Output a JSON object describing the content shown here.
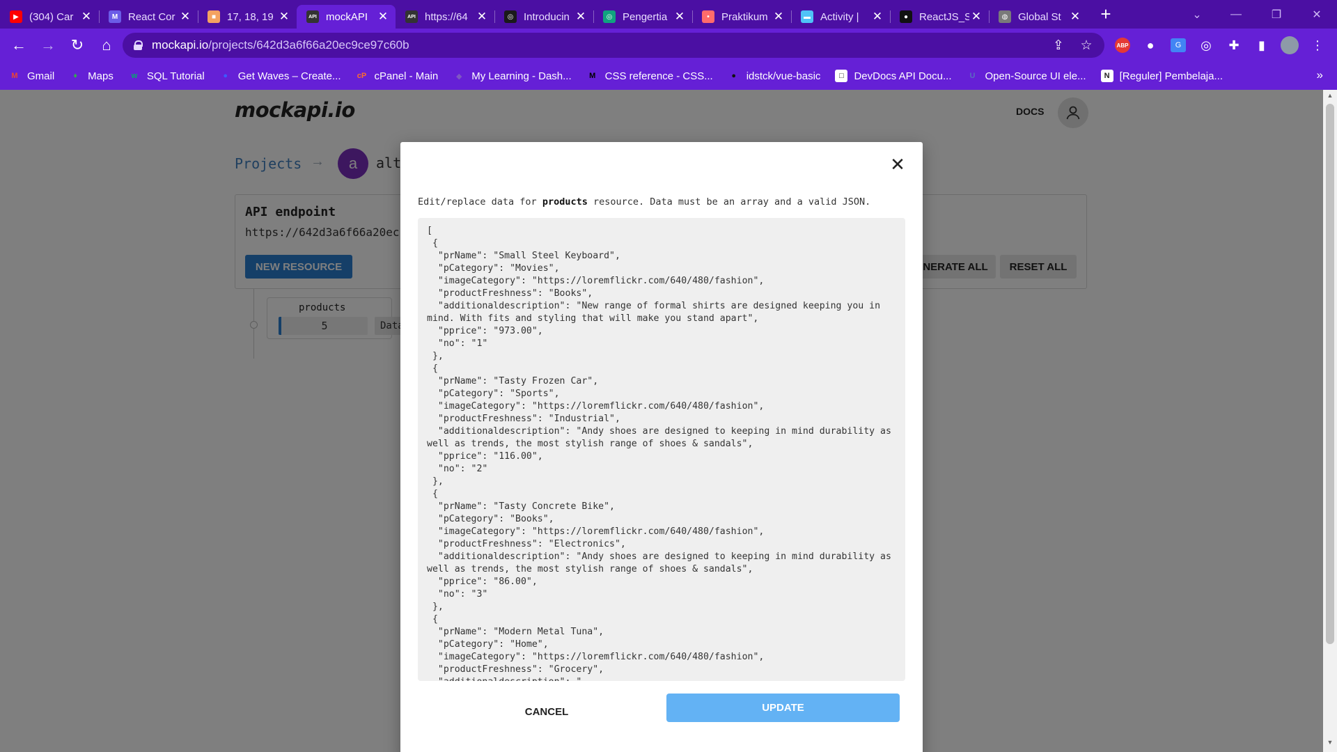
{
  "browser": {
    "tabs": [
      {
        "title": "(304) Car",
        "icon": "youtube-icon",
        "color": "#ff0000",
        "glyph": "▶"
      },
      {
        "title": "React Cor",
        "icon": "react-course-icon",
        "color": "#6b5ce7",
        "glyph": "M"
      },
      {
        "title": "17, 18, 19",
        "icon": "bookmark-page-icon",
        "color": "#f4a261",
        "glyph": "■"
      },
      {
        "title": "mockAPI",
        "icon": "mockapi-icon",
        "color": "#333333",
        "glyph": "API"
      },
      {
        "title": "https://64",
        "icon": "mockapi-icon",
        "color": "#333333",
        "glyph": "API"
      },
      {
        "title": "Introducin",
        "icon": "openai-icon",
        "color": "#1a1a1a",
        "glyph": "◎"
      },
      {
        "title": "Pengertia",
        "icon": "chatgpt-icon",
        "color": "#10a37f",
        "glyph": "◎"
      },
      {
        "title": "Praktikum",
        "icon": "web-icon",
        "color": "#ff6b6b",
        "glyph": "•"
      },
      {
        "title": "Activity |",
        "icon": "activity-icon",
        "color": "#4fc3f7",
        "glyph": "▬"
      },
      {
        "title": "ReactJS_S",
        "icon": "github-icon",
        "color": "#111111",
        "glyph": "●"
      },
      {
        "title": "Global St",
        "icon": "globe-icon",
        "color": "#7a7a7a",
        "glyph": "◍"
      }
    ],
    "url_host": "mockapi.io",
    "url_path": "/projects/642d3a6f66a20ec9ce97c60b",
    "bookmarks": [
      {
        "label": "Gmail",
        "icon": "gmail-icon",
        "color": "#ea4335",
        "glyph": "M"
      },
      {
        "label": "Maps",
        "icon": "maps-icon",
        "color": "#34a853",
        "glyph": "♦"
      },
      {
        "label": "SQL Tutorial",
        "icon": "w3schools-icon",
        "color": "#04aa6d",
        "glyph": "w"
      },
      {
        "label": "Get Waves – Create...",
        "icon": "waves-icon",
        "color": "#3d5afe",
        "glyph": "●"
      },
      {
        "label": "cPanel - Main",
        "icon": "cpanel-icon",
        "color": "#ff6c2c",
        "glyph": "cP"
      },
      {
        "label": "My Learning - Dash...",
        "icon": "learning-icon",
        "color": "#7e57c2",
        "glyph": "◆"
      },
      {
        "label": "CSS reference - CSS...",
        "icon": "mdn-icon",
        "color": "#000000",
        "glyph": "M"
      },
      {
        "label": "idstck/vue-basic",
        "icon": "github-icon",
        "color": "#111111",
        "glyph": "●"
      },
      {
        "label": "DevDocs API Docu...",
        "icon": "devdocs-icon",
        "color": "#ffffff",
        "glyph": "□"
      },
      {
        "label": "Open-Source UI ele...",
        "icon": "ui-icon",
        "color": "#5c6bc0",
        "glyph": "U"
      },
      {
        "label": "[Reguler] Pembelaja...",
        "icon": "notion-icon",
        "color": "#ffffff",
        "glyph": "N"
      }
    ]
  },
  "page": {
    "logo": "mockapi.io",
    "docs_label": "DOCS",
    "breadcrumb_projects": "Projects",
    "project_avatar_letter": "a",
    "project_name": "alt",
    "card_title": "API endpoint",
    "card_url": "https://642d3a6f66a20ec",
    "new_resource_label": "NEW RESOURCE",
    "generate_all_label": "NERATE ALL",
    "reset_all_label": "RESET ALL",
    "resource": {
      "name": "products",
      "count": "5",
      "data_label": "Data"
    }
  },
  "modal": {
    "desc_prefix": "Edit/replace data for ",
    "desc_resource": "products",
    "desc_suffix": " resource. Data must be an array and a valid JSON.",
    "json_text": "[\n {\n  \"prName\": \"Small Steel Keyboard\",\n  \"pCategory\": \"Movies\",\n  \"imageCategory\": \"https://loremflickr.com/640/480/fashion\",\n  \"productFreshness\": \"Books\",\n  \"additionaldescription\": \"New range of formal shirts are designed keeping you in mind. With fits and styling that will make you stand apart\",\n  \"pprice\": \"973.00\",\n  \"no\": \"1\"\n },\n {\n  \"prName\": \"Tasty Frozen Car\",\n  \"pCategory\": \"Sports\",\n  \"imageCategory\": \"https://loremflickr.com/640/480/fashion\",\n  \"productFreshness\": \"Industrial\",\n  \"additionaldescription\": \"Andy shoes are designed to keeping in mind durability as well as trends, the most stylish range of shoes & sandals\",\n  \"pprice\": \"116.00\",\n  \"no\": \"2\"\n },\n {\n  \"prName\": \"Tasty Concrete Bike\",\n  \"pCategory\": \"Books\",\n  \"imageCategory\": \"https://loremflickr.com/640/480/fashion\",\n  \"productFreshness\": \"Electronics\",\n  \"additionaldescription\": \"Andy shoes are designed to keeping in mind durability as well as trends, the most stylish range of shoes & sandals\",\n  \"pprice\": \"86.00\",\n  \"no\": \"3\"\n },\n {\n  \"prName\": \"Modern Metal Tuna\",\n  \"pCategory\": \"Home\",\n  \"imageCategory\": \"https://loremflickr.com/640/480/fashion\",\n  \"productFreshness\": \"Grocery\",\n  \"additionaldescription\": \"",
    "cancel_label": "CANCEL",
    "update_label": "UPDATE"
  },
  "colors": {
    "tabstrip": "#4b0fa3",
    "toolbar": "#6520d6",
    "primary_button": "#2b7fd1",
    "update_button": "#63b2f4",
    "project_avatar": "#7b2fbf"
  }
}
